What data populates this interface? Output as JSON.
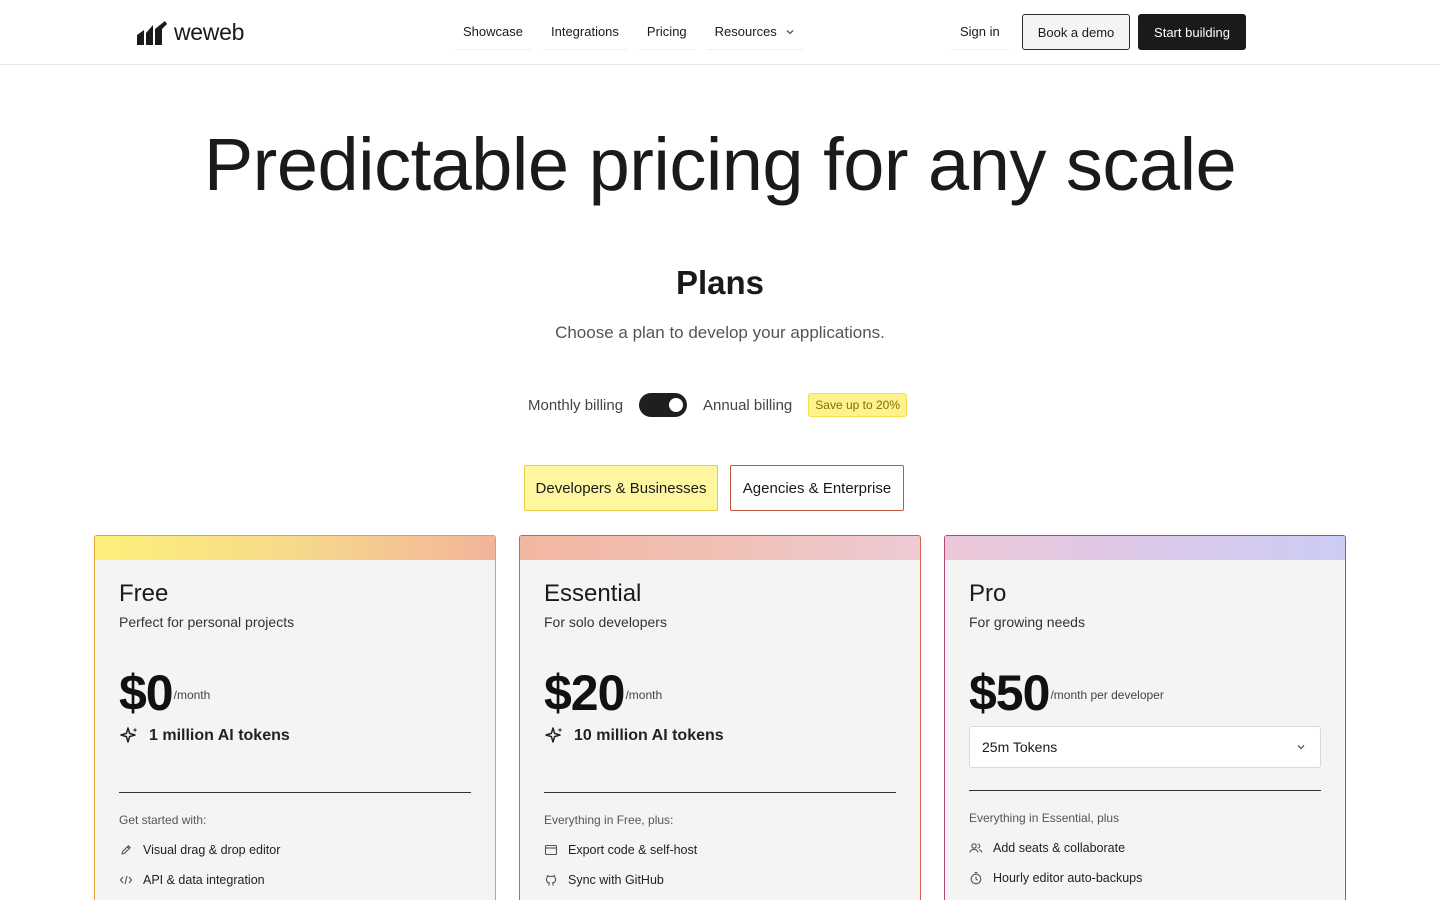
{
  "brand": {
    "name": "weweb"
  },
  "nav": {
    "items": [
      "Showcase",
      "Integrations",
      "Pricing",
      "Resources"
    ]
  },
  "header_actions": {
    "sign_in": "Sign in",
    "book_demo": "Book a demo",
    "start_building": "Start building"
  },
  "hero": {
    "title": "Predictable pricing for any scale"
  },
  "plans_section": {
    "title": "Plans",
    "subtitle": "Choose a plan to develop your applications."
  },
  "billing": {
    "monthly_label": "Monthly billing",
    "annual_label": "Annual billing",
    "save_badge": "Save up to 20%",
    "annual_selected": true
  },
  "segments": {
    "developers": "Developers & Businesses",
    "agencies": "Agencies & Enterprise",
    "selected": "developers"
  },
  "cards": [
    {
      "name": "Free",
      "tagline": "Perfect for personal projects",
      "price": "$0",
      "price_unit": "/month",
      "tokens": "1 million AI tokens",
      "features_heading": "Get started with:",
      "features": [
        {
          "label": "Visual drag & drop editor",
          "icon": "pencil-icon"
        },
        {
          "label": "API & data integration",
          "icon": "code-icon"
        }
      ]
    },
    {
      "name": "Essential",
      "tagline": "For solo developers",
      "price": "$20",
      "price_unit": "/month",
      "tokens": "10 million AI tokens",
      "features_heading": "Everything in Free, plus:",
      "features": [
        {
          "label": "Export code & self-host",
          "icon": "window-icon"
        },
        {
          "label": "Sync with GitHub",
          "icon": "github-icon"
        }
      ]
    },
    {
      "name": "Pro",
      "tagline": "For growing needs",
      "price": "$50",
      "price_unit": "/month per developer",
      "token_select": "25m Tokens",
      "features_heading": "Everything in Essential, plus",
      "features": [
        {
          "label": "Add seats & collaborate",
          "icon": "users-icon"
        },
        {
          "label": "Hourly editor auto-backups",
          "icon": "timer-icon"
        }
      ]
    }
  ],
  "colors": {
    "accent_dark": "#1a1a1a",
    "badge_yellow": "#fdf28c",
    "segment_active": "#fff7a0"
  }
}
